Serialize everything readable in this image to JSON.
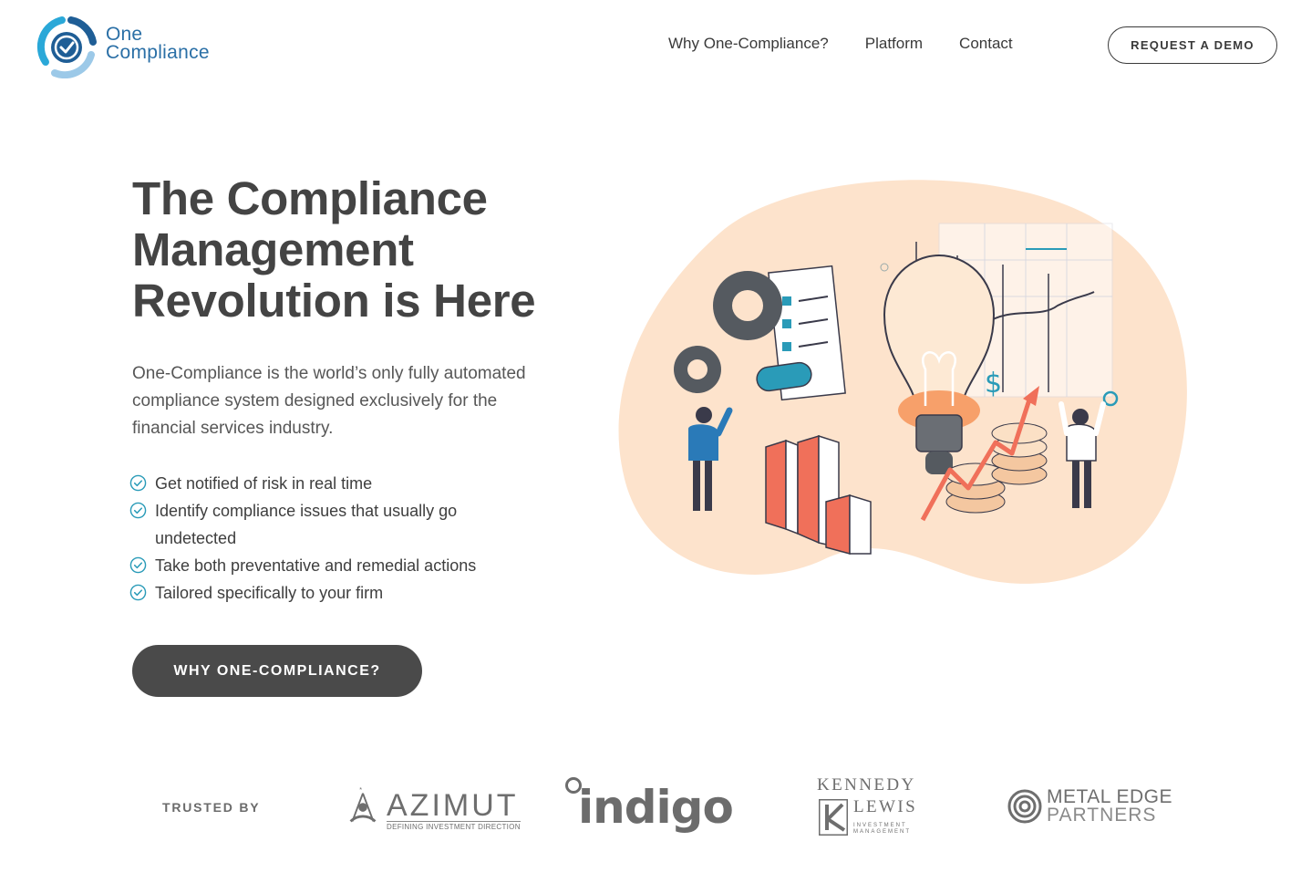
{
  "header": {
    "logo": {
      "line1": "One",
      "line2": "Compliance"
    },
    "nav": [
      {
        "label": "Why One-Compliance?"
      },
      {
        "label": "Platform"
      },
      {
        "label": "Contact"
      }
    ],
    "demo_button": "REQUEST A DEMO"
  },
  "hero": {
    "title": "The Compliance Management Revolution is Here",
    "subtitle": "One-Compliance is the world’s only fully automated compliance system designed exclusively for the financial services industry.",
    "bullets": [
      "Get notified of risk in real time",
      "Identify compliance issues that usually go undetected",
      "Take both preventative and remedial actions",
      "Tailored specifically to your firm"
    ],
    "cta": "WHY ONE-COMPLIANCE?"
  },
  "trusted": {
    "label": "TRUSTED BY",
    "partners": {
      "azimut": {
        "name": "AZIMUT",
        "tagline": "DEFINING INVESTMENT DIRECTION"
      },
      "indigo": {
        "name": "indigo"
      },
      "kennedy": {
        "line1": "KENNEDY",
        "line2": "LEWIS",
        "line3": "INVESTMENT MANAGEMENT"
      },
      "metal": {
        "line1": "METAL EDGE",
        "line2": "PARTNERS"
      }
    }
  },
  "colors": {
    "brand_blue": "#2a6fa6",
    "dark_button": "#4a4a4a",
    "blob_peach": "#fde3cc",
    "accent_red": "#f0705a",
    "check_teal": "#2a9bb8"
  }
}
